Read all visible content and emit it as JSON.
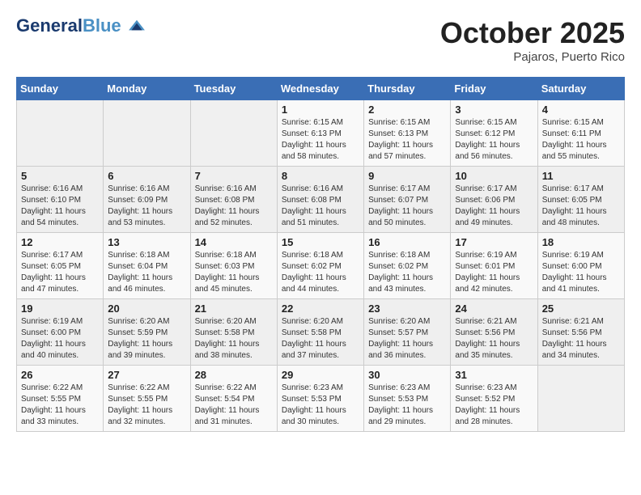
{
  "header": {
    "logo_line1": "General",
    "logo_line2": "Blue",
    "month": "October 2025",
    "location": "Pajaros, Puerto Rico"
  },
  "weekdays": [
    "Sunday",
    "Monday",
    "Tuesday",
    "Wednesday",
    "Thursday",
    "Friday",
    "Saturday"
  ],
  "weeks": [
    [
      {
        "day": "",
        "sunrise": "",
        "sunset": "",
        "daylight": ""
      },
      {
        "day": "",
        "sunrise": "",
        "sunset": "",
        "daylight": ""
      },
      {
        "day": "",
        "sunrise": "",
        "sunset": "",
        "daylight": ""
      },
      {
        "day": "1",
        "sunrise": "Sunrise: 6:15 AM",
        "sunset": "Sunset: 6:13 PM",
        "daylight": "Daylight: 11 hours and 58 minutes."
      },
      {
        "day": "2",
        "sunrise": "Sunrise: 6:15 AM",
        "sunset": "Sunset: 6:13 PM",
        "daylight": "Daylight: 11 hours and 57 minutes."
      },
      {
        "day": "3",
        "sunrise": "Sunrise: 6:15 AM",
        "sunset": "Sunset: 6:12 PM",
        "daylight": "Daylight: 11 hours and 56 minutes."
      },
      {
        "day": "4",
        "sunrise": "Sunrise: 6:15 AM",
        "sunset": "Sunset: 6:11 PM",
        "daylight": "Daylight: 11 hours and 55 minutes."
      }
    ],
    [
      {
        "day": "5",
        "sunrise": "Sunrise: 6:16 AM",
        "sunset": "Sunset: 6:10 PM",
        "daylight": "Daylight: 11 hours and 54 minutes."
      },
      {
        "day": "6",
        "sunrise": "Sunrise: 6:16 AM",
        "sunset": "Sunset: 6:09 PM",
        "daylight": "Daylight: 11 hours and 53 minutes."
      },
      {
        "day": "7",
        "sunrise": "Sunrise: 6:16 AM",
        "sunset": "Sunset: 6:08 PM",
        "daylight": "Daylight: 11 hours and 52 minutes."
      },
      {
        "day": "8",
        "sunrise": "Sunrise: 6:16 AM",
        "sunset": "Sunset: 6:08 PM",
        "daylight": "Daylight: 11 hours and 51 minutes."
      },
      {
        "day": "9",
        "sunrise": "Sunrise: 6:17 AM",
        "sunset": "Sunset: 6:07 PM",
        "daylight": "Daylight: 11 hours and 50 minutes."
      },
      {
        "day": "10",
        "sunrise": "Sunrise: 6:17 AM",
        "sunset": "Sunset: 6:06 PM",
        "daylight": "Daylight: 11 hours and 49 minutes."
      },
      {
        "day": "11",
        "sunrise": "Sunrise: 6:17 AM",
        "sunset": "Sunset: 6:05 PM",
        "daylight": "Daylight: 11 hours and 48 minutes."
      }
    ],
    [
      {
        "day": "12",
        "sunrise": "Sunrise: 6:17 AM",
        "sunset": "Sunset: 6:05 PM",
        "daylight": "Daylight: 11 hours and 47 minutes."
      },
      {
        "day": "13",
        "sunrise": "Sunrise: 6:18 AM",
        "sunset": "Sunset: 6:04 PM",
        "daylight": "Daylight: 11 hours and 46 minutes."
      },
      {
        "day": "14",
        "sunrise": "Sunrise: 6:18 AM",
        "sunset": "Sunset: 6:03 PM",
        "daylight": "Daylight: 11 hours and 45 minutes."
      },
      {
        "day": "15",
        "sunrise": "Sunrise: 6:18 AM",
        "sunset": "Sunset: 6:02 PM",
        "daylight": "Daylight: 11 hours and 44 minutes."
      },
      {
        "day": "16",
        "sunrise": "Sunrise: 6:18 AM",
        "sunset": "Sunset: 6:02 PM",
        "daylight": "Daylight: 11 hours and 43 minutes."
      },
      {
        "day": "17",
        "sunrise": "Sunrise: 6:19 AM",
        "sunset": "Sunset: 6:01 PM",
        "daylight": "Daylight: 11 hours and 42 minutes."
      },
      {
        "day": "18",
        "sunrise": "Sunrise: 6:19 AM",
        "sunset": "Sunset: 6:00 PM",
        "daylight": "Daylight: 11 hours and 41 minutes."
      }
    ],
    [
      {
        "day": "19",
        "sunrise": "Sunrise: 6:19 AM",
        "sunset": "Sunset: 6:00 PM",
        "daylight": "Daylight: 11 hours and 40 minutes."
      },
      {
        "day": "20",
        "sunrise": "Sunrise: 6:20 AM",
        "sunset": "Sunset: 5:59 PM",
        "daylight": "Daylight: 11 hours and 39 minutes."
      },
      {
        "day": "21",
        "sunrise": "Sunrise: 6:20 AM",
        "sunset": "Sunset: 5:58 PM",
        "daylight": "Daylight: 11 hours and 38 minutes."
      },
      {
        "day": "22",
        "sunrise": "Sunrise: 6:20 AM",
        "sunset": "Sunset: 5:58 PM",
        "daylight": "Daylight: 11 hours and 37 minutes."
      },
      {
        "day": "23",
        "sunrise": "Sunrise: 6:20 AM",
        "sunset": "Sunset: 5:57 PM",
        "daylight": "Daylight: 11 hours and 36 minutes."
      },
      {
        "day": "24",
        "sunrise": "Sunrise: 6:21 AM",
        "sunset": "Sunset: 5:56 PM",
        "daylight": "Daylight: 11 hours and 35 minutes."
      },
      {
        "day": "25",
        "sunrise": "Sunrise: 6:21 AM",
        "sunset": "Sunset: 5:56 PM",
        "daylight": "Daylight: 11 hours and 34 minutes."
      }
    ],
    [
      {
        "day": "26",
        "sunrise": "Sunrise: 6:22 AM",
        "sunset": "Sunset: 5:55 PM",
        "daylight": "Daylight: 11 hours and 33 minutes."
      },
      {
        "day": "27",
        "sunrise": "Sunrise: 6:22 AM",
        "sunset": "Sunset: 5:55 PM",
        "daylight": "Daylight: 11 hours and 32 minutes."
      },
      {
        "day": "28",
        "sunrise": "Sunrise: 6:22 AM",
        "sunset": "Sunset: 5:54 PM",
        "daylight": "Daylight: 11 hours and 31 minutes."
      },
      {
        "day": "29",
        "sunrise": "Sunrise: 6:23 AM",
        "sunset": "Sunset: 5:53 PM",
        "daylight": "Daylight: 11 hours and 30 minutes."
      },
      {
        "day": "30",
        "sunrise": "Sunrise: 6:23 AM",
        "sunset": "Sunset: 5:53 PM",
        "daylight": "Daylight: 11 hours and 29 minutes."
      },
      {
        "day": "31",
        "sunrise": "Sunrise: 6:23 AM",
        "sunset": "Sunset: 5:52 PM",
        "daylight": "Daylight: 11 hours and 28 minutes."
      },
      {
        "day": "",
        "sunrise": "",
        "sunset": "",
        "daylight": ""
      }
    ]
  ]
}
